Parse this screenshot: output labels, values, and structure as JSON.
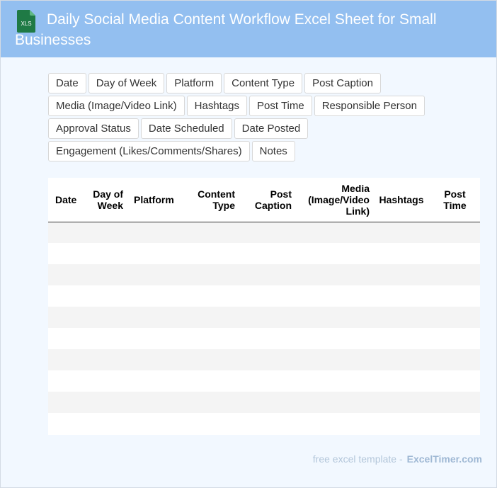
{
  "header": {
    "title": "Daily Social Media Content Workflow Excel Sheet for Small Businesses",
    "icon_label": "XLS",
    "icon": "excel-file-icon",
    "bg_color": "#93bff0"
  },
  "fields": [
    "Date",
    "Day of Week",
    "Platform",
    "Content Type",
    "Post Caption",
    "Media (Image/Video Link)",
    "Hashtags",
    "Post Time",
    "Responsible Person",
    "Approval Status",
    "Date Scheduled",
    "Date Posted",
    "Engagement (Likes/Comments/Shares)",
    "Notes"
  ],
  "table": {
    "headers": [
      "Date",
      "Day of Week",
      "Platform",
      "Content Type",
      "Post Caption",
      "Media (Image/Video Link)",
      "Hashtags",
      "Post Time"
    ],
    "row_count": 10
  },
  "footer": {
    "text": "free excel template -",
    "brand": "ExcelTimer.com"
  }
}
